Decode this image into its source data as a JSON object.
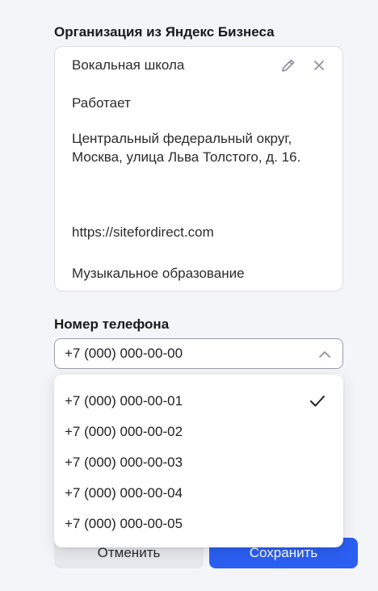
{
  "organization": {
    "section_title": "Организация из Яндекс Бизнеса",
    "name": "Вокальная школа",
    "status": "Работает",
    "address": "Центральный федеральный округ, Москва, улица Льва Толстого, д. 16.",
    "website": "https://sitefordirect.com",
    "category": "Музыкальное образование",
    "icons": {
      "edit": "pencil-icon",
      "remove": "close-icon"
    }
  },
  "phone": {
    "section_title": "Номер телефона",
    "selected_value": "+7 (000) 000-00-00",
    "expanded": true,
    "options": [
      {
        "label": "+7 (000) 000-00-01",
        "checked": true
      },
      {
        "label": "+7 (000) 000-00-02",
        "checked": false
      },
      {
        "label": "+7 (000) 000-00-03",
        "checked": false
      },
      {
        "label": "+7 (000) 000-00-04",
        "checked": false
      },
      {
        "label": "+7 (000) 000-00-05",
        "checked": false
      }
    ]
  },
  "actions": {
    "cancel_label": "Отменить",
    "save_label": "Сохранить"
  },
  "colors": {
    "background": "#f4f5f8",
    "primary": "#2b5ff2",
    "secondary_button": "#e6e8ed",
    "icon_gray": "#8c9099"
  }
}
